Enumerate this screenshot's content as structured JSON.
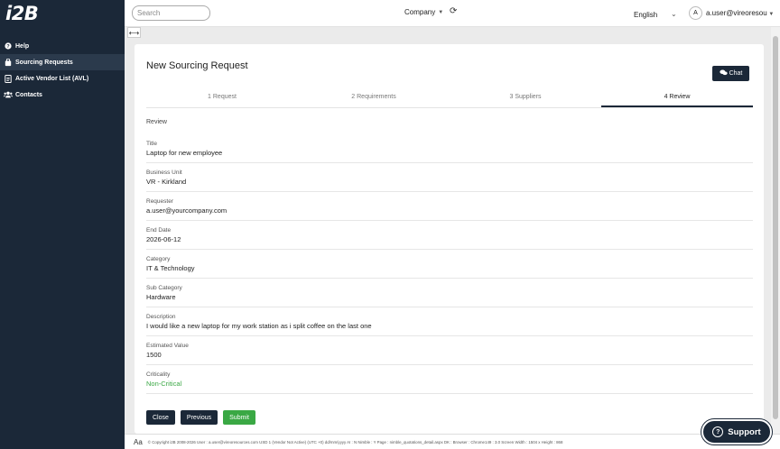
{
  "app": {
    "logo": "i2B"
  },
  "sidebar": {
    "items": [
      {
        "label": "Help",
        "icon": "question-circle-icon",
        "active": false
      },
      {
        "label": "Sourcing Requests",
        "icon": "shopping-bag-icon",
        "active": true
      },
      {
        "label": "Active Vendor List (AVL)",
        "icon": "list-icon",
        "active": false
      },
      {
        "label": "Contacts",
        "icon": "users-icon",
        "active": false
      }
    ]
  },
  "topbar": {
    "search_placeholder": "Search",
    "company_label": "Company",
    "language": "English",
    "avatar_initial": "A",
    "user": "a.user@vireoresou"
  },
  "form": {
    "title": "New Sourcing Request",
    "chat_label": "Chat",
    "steps": [
      "1 Request",
      "2 Requirements",
      "3 Suppliers",
      "4 Review"
    ],
    "active_step": 3,
    "review_label": "Review",
    "fields": [
      {
        "label": "Title",
        "value": "Laptop for new employee"
      },
      {
        "label": "Business Unit",
        "value": "VR - Kirkland"
      },
      {
        "label": "Requester",
        "value": "a.user@yourcompany.com"
      },
      {
        "label": "End Date",
        "value": "2026-06-12"
      },
      {
        "label": "Category",
        "value": "IT & Technology"
      },
      {
        "label": "Sub Category",
        "value": "Hardware"
      },
      {
        "label": "Description",
        "value": "I would like a new laptop for my work station as i split coffee on the last one"
      },
      {
        "label": "Estimated Value",
        "value": "1500"
      },
      {
        "label": "Criticality",
        "value": "Non-Critical"
      }
    ],
    "buttons": {
      "close": "Close",
      "previous": "Previous",
      "submit": "Submit"
    }
  },
  "footer": {
    "font_toggle": "Aa",
    "info": "© Copyright i2B 2008-2026  User : a.user@vireoresources.com  USD 1 (Vendor Not Active)  (UTC +0)  dd/mm/yyyy  AI : N  Nimble : Y  Page : nimble_quotations_detail.aspx  DK : Browser : Chrome149 : 3.0  Screen Width : 1504  x Height : 868"
  },
  "support": {
    "label": "Support"
  },
  "colors": {
    "sidebar": "#1b2838",
    "accent_green": "#3aa844"
  }
}
